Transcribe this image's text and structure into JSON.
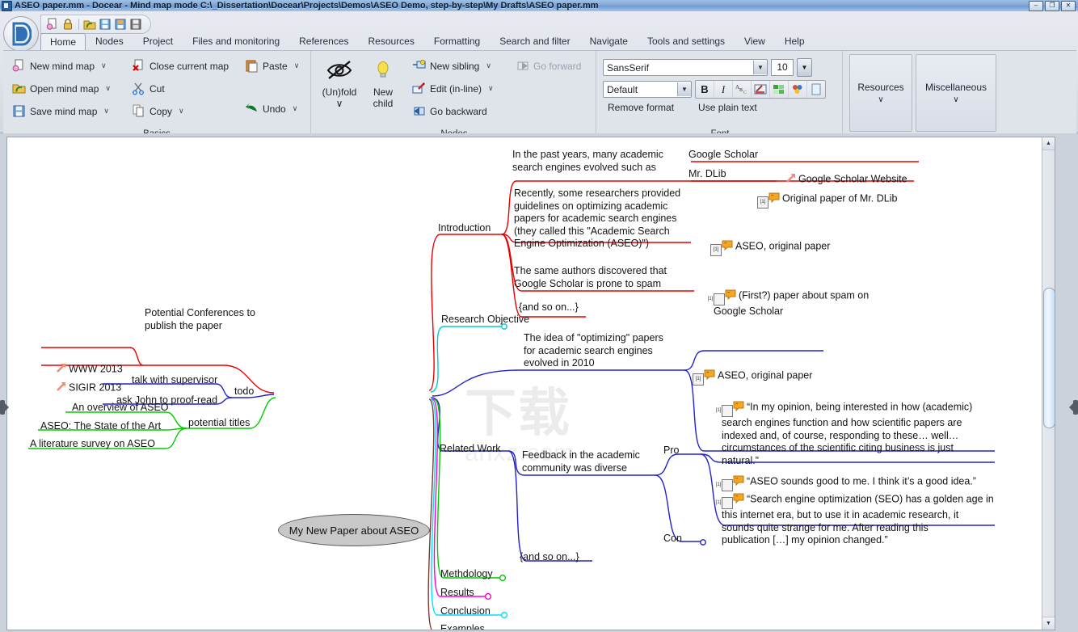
{
  "window": {
    "title": "ASEO paper.mm - Docear - Mind map mode C:\\_Dissertation\\Docear\\Projects\\Demos\\ASEO Demo, step-by-step\\My Drafts\\ASEO paper.mm",
    "minimize": "–",
    "maximize": "❐",
    "close": "✕"
  },
  "quick_access": {
    "icons": [
      "new-icon",
      "lock-icon",
      "open-folder-icon",
      "save-icon",
      "save-as-icon",
      "save-all-icon"
    ]
  },
  "tabs": [
    {
      "label": "Home",
      "active": true
    },
    {
      "label": "Nodes",
      "active": false
    },
    {
      "label": "Project",
      "active": false
    },
    {
      "label": "Files and monitoring",
      "active": false
    },
    {
      "label": "References",
      "active": false
    },
    {
      "label": "Resources",
      "active": false
    },
    {
      "label": "Formatting",
      "active": false
    },
    {
      "label": "Search and filter",
      "active": false
    },
    {
      "label": "Navigate",
      "active": false
    },
    {
      "label": "Tools and settings",
      "active": false
    },
    {
      "label": "View",
      "active": false
    },
    {
      "label": "Help",
      "active": false
    }
  ],
  "ribbon": {
    "basics": {
      "title": "Basics",
      "col1": [
        {
          "label": "New mind map",
          "icon": "new-map-icon",
          "caret": "∨"
        },
        {
          "label": "Open mind map",
          "icon": "open-map-icon",
          "caret": "∨"
        },
        {
          "label": "Save mind map",
          "icon": "save-map-icon",
          "caret": "∨"
        }
      ],
      "col2": [
        {
          "label": "Close current map",
          "icon": "close-map-icon",
          "caret": ""
        },
        {
          "label": "Cut",
          "icon": "cut-icon",
          "caret": ""
        },
        {
          "label": "Copy",
          "icon": "copy-icon",
          "caret": "∨"
        }
      ],
      "col3": [
        {
          "label": "Paste",
          "icon": "paste-icon",
          "caret": "∨"
        },
        {
          "label": "Undo",
          "icon": "undo-icon",
          "caret": "∨"
        }
      ]
    },
    "nodes": {
      "title": "Nodes",
      "big": [
        {
          "label": "(Un)fold",
          "icon": "unfold-eye-icon",
          "caret": "∨"
        },
        {
          "label": "New\nchild",
          "icon": "lightbulb-icon",
          "caret": ""
        }
      ],
      "items": [
        {
          "label": "New sibling",
          "icon": "new-sibling-icon",
          "caret": "∨",
          "disabled": false
        },
        {
          "label": "Edit (in-line)",
          "icon": "edit-inline-icon",
          "caret": "∨",
          "disabled": false
        },
        {
          "label": "Go backward",
          "icon": "go-backward-icon",
          "caret": "",
          "disabled": false
        }
      ],
      "items2": [
        {
          "label": "Go forward",
          "icon": "go-forward-icon",
          "caret": "",
          "disabled": true
        }
      ]
    },
    "font": {
      "title": "Font",
      "family": "SansSerif",
      "size": "10",
      "style": "Default",
      "buttons": [
        "B",
        "I",
        "A",
        "✎",
        "▦",
        "✿",
        "□"
      ],
      "bold_label": "B",
      "italic_label": "I",
      "remove_format": "Remove format",
      "use_plain_text": "Use plain text"
    },
    "side_buttons": [
      {
        "label": "Resources",
        "caret": "∨"
      },
      {
        "label": "Miscellaneous",
        "caret": "∨"
      }
    ]
  },
  "map": {
    "root": "My New Paper about ASEO",
    "watermark_main": "下载",
    "watermark_sub": "anxz.com",
    "left_branches": [
      {
        "label": "Potential Conferences to\npublish the paper",
        "color": "#e60000",
        "children": [
          {
            "label": "WWW 2013",
            "icon": "link-arrow-icon"
          },
          {
            "label": "SIGIR 2013",
            "icon": "link-arrow-icon"
          }
        ]
      },
      {
        "label": "todo",
        "color": "#2222cc",
        "children": [
          {
            "label": "talk with supervisor",
            "icon": ""
          },
          {
            "label": "ask John to proof-read",
            "icon": ""
          }
        ]
      },
      {
        "label": "potential titles",
        "color": "#00dd00",
        "children": [
          {
            "label": "An overview of ASEO",
            "icon": ""
          },
          {
            "label": "ASEO: The State of the Art",
            "icon": ""
          },
          {
            "label": "A literature survey on ASEO",
            "icon": ""
          }
        ]
      }
    ],
    "right_branches": [
      {
        "label": "Introduction",
        "color": "#e60000",
        "children": [
          {
            "label": "In the past years, many academic\nsearch engines evolved such as",
            "children": [
              {
                "label": "Google Scholar",
                "children": [
                  {
                    "label": "Google Scholar Website",
                    "icon": "link-arrow-icon"
                  }
                ]
              },
              {
                "label": "Mr. DLib",
                "children": [
                  {
                    "label": "Original paper of Mr. DLib",
                    "icon": "reference-bubble-icon"
                  }
                ]
              }
            ]
          },
          {
            "label": "Recently, some researchers provided\nguidelines on optimizing academic\npapers for academic search engines\n(they called this \"Academic Search\nEngine Optimization (ASEO)\")",
            "children": [
              {
                "label": "ASEO, original paper",
                "icon": "reference-bubble-icon"
              }
            ]
          },
          {
            "label": "The same authors discovered that\nGoogle Scholar is prone to spam",
            "children": [
              {
                "label": "(First?) paper about spam on\nGoogle Scholar",
                "icon": "reference-bubble-icon"
              }
            ]
          },
          {
            "label": "{and so on...}",
            "children": []
          }
        ]
      },
      {
        "label": "Research Objective",
        "color": "#00cccc",
        "children": []
      },
      {
        "label": "",
        "color": "#2222cc",
        "children": [
          {
            "label": "The idea of \"optimizing\" papers\nfor academic search engines\nevolved in 2010",
            "children": [
              {
                "label": "ASEO, original paper",
                "icon": "reference-bubble-icon"
              },
              {
                "label": "“In my opinion, being interested in how (academic)\nsearch engines function and how scientific papers are\nindexed and, of course, responding to these… well…\ncircumstances of the scientific citing business is just\nnatural.”",
                "icon": "reference-bubble-icon"
              }
            ]
          }
        ]
      },
      {
        "label": "Related Work",
        "color": "#2222cc",
        "children": [
          {
            "label": "Feedback in the academic\ncommunity was diverse",
            "children": [
              {
                "label": "Pro",
                "children": [
                  {
                    "label": "“ASEO sounds good to me. I think it’s a good idea.”",
                    "icon": "reference-bubble-icon"
                  },
                  {
                    "label": "“Search engine optimization (SEO) has a golden age in\nthis internet era, but to use it in academic research, it\nsounds quite strange for me. After reading this\npublication […] my opinion changed.”",
                    "icon": "reference-bubble-icon"
                  }
                ]
              },
              {
                "label": "Con",
                "children": []
              }
            ]
          },
          {
            "label": "{and so on...}",
            "children": []
          }
        ]
      },
      {
        "label": "Methdology",
        "color": "#00dd00",
        "children": []
      },
      {
        "label": "Results",
        "color": "#ff00cc",
        "children": []
      },
      {
        "label": "Conclusion",
        "color": "#00ddff",
        "children": []
      },
      {
        "label": "Examples",
        "color": "#7a3b2e",
        "children": []
      }
    ]
  }
}
